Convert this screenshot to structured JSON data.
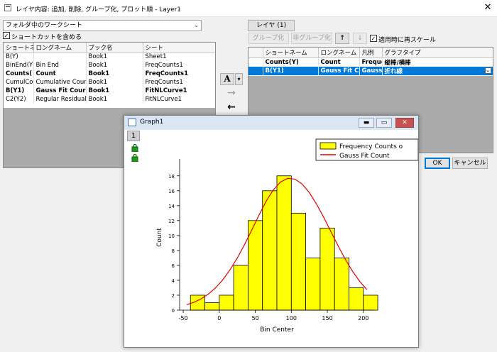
{
  "window": {
    "title": "レイヤ内容: 追加, 削除, グループ化, プロット順 - Layer1",
    "close_glyph": "✕"
  },
  "left_panel": {
    "folder_combo": "フォルダ中のワークシート",
    "shortcut_checkbox_label": "ショートカットを含める",
    "shortcut_checked": true,
    "columns": [
      "ショートネ",
      "ロングネーム",
      "ブック名",
      "シート"
    ],
    "rows": [
      {
        "cells": [
          "B(Y)",
          "",
          "Book1",
          "Sheet1"
        ],
        "bold": false
      },
      {
        "cells": [
          "BinEnd(Y",
          "Bin End",
          "Book1",
          "FreqCounts1"
        ],
        "bold": false
      },
      {
        "cells": [
          "Counts(",
          "Count",
          "Book1",
          "FreqCounts1"
        ],
        "bold": true
      },
      {
        "cells": [
          "CumulCo",
          "Cumulative Count",
          "Book1",
          "FreqCounts1"
        ],
        "bold": false
      },
      {
        "cells": [
          "B(Y1)",
          "Gauss Fit Cour",
          "Book1",
          "FitNLCurve1"
        ],
        "bold": true
      },
      {
        "cells": [
          "C2(Y2)",
          "Regular Residual",
          "Book1",
          "FitNLCurve1"
        ],
        "bold": false
      }
    ]
  },
  "middle_buttons": {
    "font_button": "A",
    "dropdown": "▾",
    "add_arrow": "→",
    "remove_arrow": "←"
  },
  "right_panel": {
    "layer_button": "レイヤ (1)",
    "group_button": "グループ化",
    "ungroup_button": "非グループ化",
    "up_arrow": "↑",
    "down_arrow": "↓",
    "rescale_label": "適用時に再スケール",
    "rescale_checked": true,
    "columns": [
      "ショートネーム",
      "ロングネーム",
      "凡例",
      "グラフタイプ"
    ],
    "rows": [
      {
        "cells": [
          "Counts(Y)",
          "Count",
          "Freque",
          "縦棒/横棒"
        ],
        "selected": false
      },
      {
        "cells": [
          "B(Y1)",
          "Gauss Fit C",
          "Gauss",
          "折れ線"
        ],
        "selected": true
      }
    ],
    "ok_button": "OK",
    "cancel_button": "キャンセル"
  },
  "graph_window": {
    "title": "Graph1",
    "layer_number": "1",
    "min_glyph": "▬",
    "max_glyph": "▭",
    "close_glyph": "✕"
  },
  "chart_data": {
    "type": "bar",
    "xlabel": "Bin Center",
    "ylabel": "Count",
    "xlim": [
      -55,
      215
    ],
    "ylim": [
      0,
      19.5
    ],
    "xticks": [
      -50,
      0,
      50,
      100,
      150,
      200
    ],
    "yticks": [
      0,
      2,
      4,
      6,
      8,
      10,
      12,
      14,
      16,
      18
    ],
    "bar_width": 20,
    "series": [
      {
        "name": "Frequency Counts o",
        "kind": "bar",
        "color": "#ffff00",
        "x": [
          -30,
          -10,
          10,
          30,
          50,
          70,
          90,
          110,
          130,
          150,
          170,
          190,
          210
        ],
        "values": [
          2,
          1,
          2,
          6,
          12,
          16,
          18,
          13,
          7,
          11,
          7,
          3,
          2
        ]
      },
      {
        "name": "Gauss Fit Count",
        "kind": "line",
        "color": "#e00000",
        "x": [
          -45,
          -35,
          -25,
          -15,
          -5,
          5,
          15,
          25,
          35,
          45,
          55,
          65,
          75,
          85,
          95,
          105,
          115,
          125,
          135,
          145,
          155,
          165,
          175,
          185,
          195,
          205
        ],
        "y": [
          0.73,
          1.06,
          1.52,
          2.16,
          3.0,
          4.08,
          5.41,
          6.98,
          8.77,
          10.71,
          12.7,
          14.58,
          16.1,
          17.17,
          17.66,
          17.56,
          16.9,
          15.75,
          14.22,
          12.43,
          10.51,
          8.6,
          6.8,
          5.19,
          3.84,
          2.74
        ]
      }
    ],
    "legend": {
      "position": "top-right"
    }
  }
}
